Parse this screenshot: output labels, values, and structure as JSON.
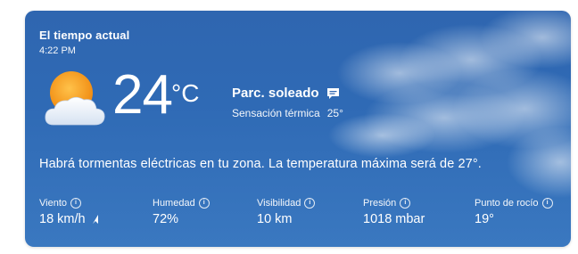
{
  "header": {
    "title": "El tiempo actual",
    "time": "4:22 PM"
  },
  "current": {
    "temperature": "24",
    "unit": "°C",
    "condition": "Parc. soleado",
    "feels_like_label": "Sensación térmica",
    "feels_like_value": "25°",
    "icon": "partly-sunny-icon"
  },
  "summary": "Habrá tormentas eléctricas en tu zona. La temperatura máxima será de 27°.",
  "stats": [
    {
      "label": "Viento",
      "value": "18 km/h"
    },
    {
      "label": "Humedad",
      "value": "72%"
    },
    {
      "label": "Visibilidad",
      "value": "10 km"
    },
    {
      "label": "Presión",
      "value": "1018 mbar"
    },
    {
      "label": "Punto de rocío",
      "value": "19°"
    }
  ],
  "colors": {
    "card_background": "#2f66b0",
    "sun": "#f6a21e",
    "text": "#ffffff"
  }
}
